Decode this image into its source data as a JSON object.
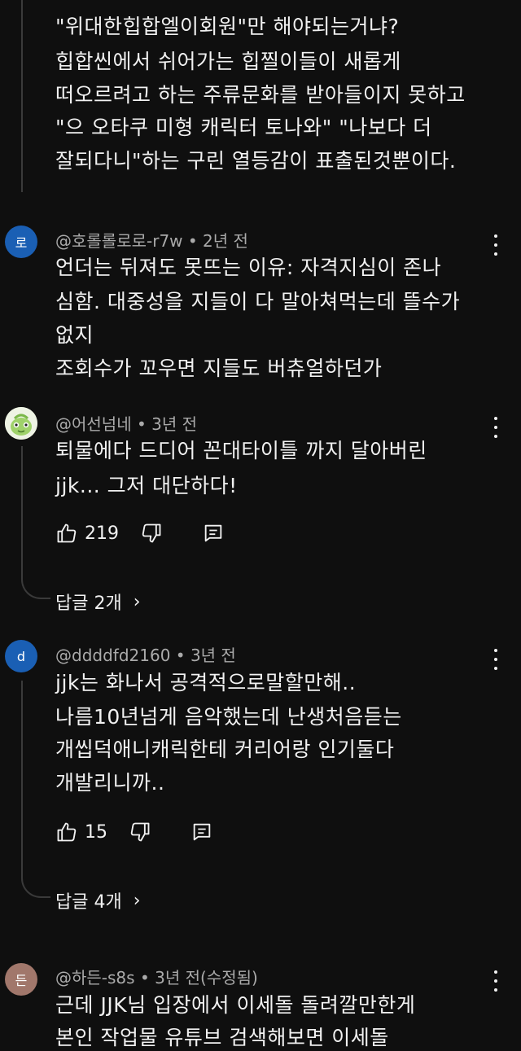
{
  "top_comment": {
    "lines": [
      "\"위대한힙합엘이회원\"만 해야되는거냐?",
      "힙합씬에서 쉬어가는 힙찔이들이 새롭게",
      "떠오르려고 하는 주류문화를 받아들이지 못하고",
      "\"으 오타쿠 미형 캐릭터 토나와\" \"나보다 더",
      "잘되다니\"하는 구린 열등감이 표출된것뿐이다."
    ]
  },
  "comments": [
    {
      "avatar_text": "로",
      "avatar_color": "#1a5fb4",
      "author": "@호롤롤로로-r7w",
      "time": "2년 전",
      "lines": [
        "언더는 뒤져도 못뜨는 이유: 자격지심이 존나",
        "심함. 대중성을 지들이 다 말아쳐먹는데 뜰수가",
        "없지",
        "조회수가 꼬우면 지들도 버츄얼하던가"
      ]
    },
    {
      "avatar_text": "",
      "avatar_color": "#e8f0d8",
      "author": "@어선넘네",
      "time": "3년 전",
      "lines": [
        "퇴물에다 드디어 꼰대타이틀 까지 달아버린",
        "jjk... 그저 대단하다!"
      ],
      "likes": "219",
      "replies": "답글 2개"
    },
    {
      "avatar_text": "d",
      "avatar_color": "#1a5fb4",
      "author": "@ddddfd2160",
      "time": "3년 전",
      "lines": [
        "jjk는 화나서 공격적으로말할만해..",
        "나름10년넘게 음악했는데 난생처음듣는",
        "개씹덕애니캐릭한테 커리어랑 인기둘다",
        "개발리니까.."
      ],
      "likes": "15",
      "replies": "답글 4개"
    },
    {
      "avatar_text": "든",
      "avatar_color": "#a1776b",
      "author": "@하든-s8s",
      "time": "3년 전(수정됨)",
      "lines": [
        "근데 JJK님 입장에서 이세돌 돌려깔만한게",
        "본인 작업물 유튜브 검색해보면 이세돌"
      ]
    }
  ],
  "separator": "•",
  "icons": [
    "like-icon",
    "dislike-icon",
    "reply-icon",
    "more-icon",
    "chevron-right-icon"
  ]
}
